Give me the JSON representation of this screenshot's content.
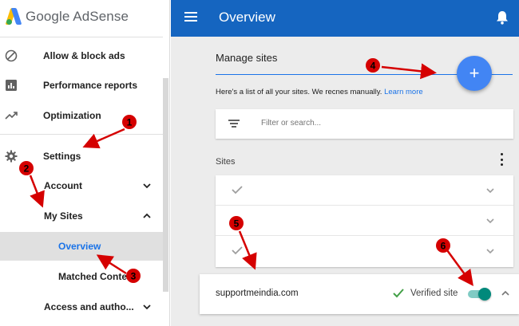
{
  "brand": {
    "name": "Google AdSense"
  },
  "sidebar": {
    "items": [
      {
        "label": "Allow & block ads",
        "icon": "block-icon"
      },
      {
        "label": "Performance reports",
        "icon": "bar-chart-icon"
      },
      {
        "label": "Optimization",
        "icon": "trending-up-icon"
      },
      {
        "label": "Settings",
        "icon": "gear-icon"
      },
      {
        "label": "Account",
        "icon": "chevron-down-icon"
      },
      {
        "label": "My Sites",
        "icon": "chevron-up-icon"
      },
      {
        "label": "Overview",
        "active": true
      },
      {
        "label": "Matched Content"
      },
      {
        "label": "Access and autho...",
        "icon": "chevron-down-icon"
      }
    ]
  },
  "header": {
    "title": "Overview",
    "menu_icon": "menu-icon",
    "notification_icon": "bell-icon",
    "color": "#1565c0"
  },
  "main": {
    "title": "Manage sites",
    "add_button": "+",
    "description": "Here's a list of all your sites. We recnes manually. ",
    "learn_more": "Learn more",
    "filter_placeholder": "Filter or search...",
    "sites_heading": "Sites",
    "site_rows": 3,
    "site": {
      "name": "supportmeindia.com",
      "status": "Verified site",
      "toggle_on": true
    }
  },
  "annotations": [
    "1",
    "2",
    "3",
    "4",
    "5",
    "6"
  ],
  "colors": {
    "accent": "#4285f4",
    "link": "#1a73e8",
    "arrow": "#d50000",
    "toggle": "#00897b",
    "verified": "#43a047"
  }
}
